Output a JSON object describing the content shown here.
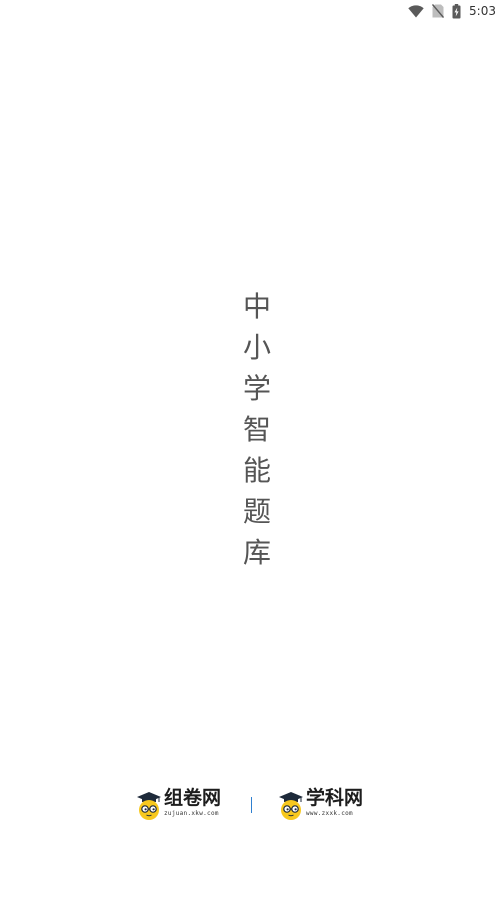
{
  "status_bar": {
    "time": "5:03",
    "icons": [
      "wifi-icon",
      "no-sim-icon",
      "battery-charging-icon"
    ]
  },
  "splash": {
    "title_chars": [
      "中",
      "小",
      "学",
      "智",
      "能",
      "题",
      "库"
    ]
  },
  "brands": {
    "zujuan": {
      "name": "组卷网",
      "url": "zujuan.xkw.com",
      "icon": "mascot-icon"
    },
    "zxxk": {
      "name": "学科网",
      "url": "www.zxxk.com",
      "icon": "mascot-icon"
    }
  },
  "colors": {
    "background": "#ffffff",
    "title_text": "#555555",
    "mascot_yellow": "#f7c81e",
    "divider_blue": "#2f80d0"
  }
}
